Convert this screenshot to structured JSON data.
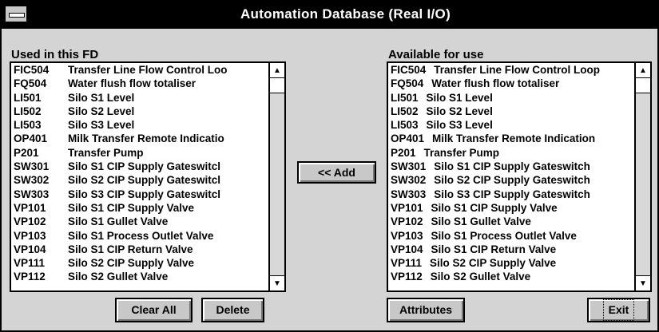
{
  "window": {
    "title": "Automation Database (Real I/O)"
  },
  "left": {
    "label": "Used in this FD",
    "items": [
      {
        "code": "FIC504",
        "desc": "Transfer Line Flow Control Loo"
      },
      {
        "code": "FQ504",
        "desc": "Water flush flow totaliser"
      },
      {
        "code": "LI501",
        "desc": "Silo S1 Level"
      },
      {
        "code": "LI502",
        "desc": "Silo S2 Level"
      },
      {
        "code": "LI503",
        "desc": "Silo S3 Level"
      },
      {
        "code": "OP401",
        "desc": "Milk Transfer Remote Indicatio"
      },
      {
        "code": "P201",
        "desc": "Transfer Pump"
      },
      {
        "code": "SW301",
        "desc": "Silo S1 CIP Supply Gateswitcl"
      },
      {
        "code": "SW302",
        "desc": "Silo S2 CIP Supply Gateswitcl"
      },
      {
        "code": "SW303",
        "desc": "Silo S3 CIP Supply Gateswitcl"
      },
      {
        "code": "VP101",
        "desc": "Silo S1 CIP Supply Valve"
      },
      {
        "code": "VP102",
        "desc": "Silo S1 Gullet Valve"
      },
      {
        "code": "VP103",
        "desc": "Silo S1 Process Outlet Valve"
      },
      {
        "code": "VP104",
        "desc": "Silo S1 CIP Return Valve"
      },
      {
        "code": "VP111",
        "desc": "Silo S2 CIP Supply Valve"
      },
      {
        "code": "VP112",
        "desc": "Silo S2 Gullet Valve"
      }
    ]
  },
  "right": {
    "label": "Available for use",
    "items": [
      {
        "code": "FIC504",
        "desc": "Transfer Line Flow Control Loop"
      },
      {
        "code": "FQ504",
        "desc": "Water flush flow totaliser"
      },
      {
        "code": "LI501",
        "desc": "Silo S1 Level"
      },
      {
        "code": "LI502",
        "desc": "Silo S2 Level"
      },
      {
        "code": "LI503",
        "desc": "Silo S3 Level"
      },
      {
        "code": "OP401",
        "desc": "Milk Transfer Remote Indication"
      },
      {
        "code": "P201",
        "desc": "Transfer Pump"
      },
      {
        "code": "SW301",
        "desc": "Silo S1 CIP Supply Gateswitch"
      },
      {
        "code": "SW302",
        "desc": "Silo S2 CIP Supply Gateswitch"
      },
      {
        "code": "SW303",
        "desc": "Silo S3 CIP Supply Gateswitch"
      },
      {
        "code": "VP101",
        "desc": "Silo S1 CIP Supply Valve"
      },
      {
        "code": "VP102",
        "desc": "Silo S1 Gullet Valve"
      },
      {
        "code": "VP103",
        "desc": "Silo S1 Process Outlet Valve"
      },
      {
        "code": "VP104",
        "desc": "Silo S1 CIP Return Valve"
      },
      {
        "code": "VP111",
        "desc": "Silo S2 CIP Supply Valve"
      },
      {
        "code": "VP112",
        "desc": "Silo S2 Gullet Valve"
      }
    ]
  },
  "buttons": {
    "add": "<< Add",
    "clear_all": "Clear All",
    "delete": "Delete",
    "attributes": "Attributes",
    "exit": "Exit"
  },
  "icons": {
    "scroll_up": "▲",
    "scroll_down": "▼"
  }
}
